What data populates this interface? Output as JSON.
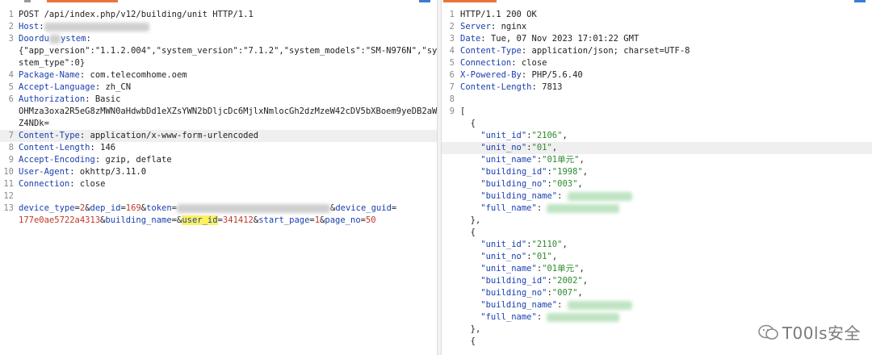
{
  "request": {
    "lines": [
      {
        "n": "1",
        "parts": [
          {
            "c": "val",
            "t": "POST /api/index.php/v12/building/unit HTTP/1.1"
          }
        ]
      },
      {
        "n": "2",
        "parts": [
          {
            "c": "key",
            "t": "Host"
          },
          {
            "c": "val",
            "t": ":"
          },
          {
            "blur": "gray",
            "w": 130
          }
        ]
      },
      {
        "n": "3",
        "parts": [
          {
            "c": "key",
            "t": "Doordu"
          },
          {
            "blur": "gray",
            "w": 14
          },
          {
            "c": "key",
            "t": "ystem"
          },
          {
            "c": "val",
            "t": ":"
          }
        ]
      },
      {
        "n": "",
        "parts": [
          {
            "c": "val",
            "t": "{\"app_version\":\"1.1.2.004\",\"system_version\":\"7.1.2\",\"system_models\":\"SM-N976N\",\"sy"
          }
        ]
      },
      {
        "n": "",
        "parts": [
          {
            "c": "val",
            "t": "stem_type\":0}"
          }
        ]
      },
      {
        "n": "4",
        "parts": [
          {
            "c": "key",
            "t": "Package-Name"
          },
          {
            "c": "val",
            "t": ": com.telecomhome.oem"
          }
        ]
      },
      {
        "n": "5",
        "parts": [
          {
            "c": "key",
            "t": "Accept-Language"
          },
          {
            "c": "val",
            "t": ": zh_CN"
          }
        ]
      },
      {
        "n": "6",
        "parts": [
          {
            "c": "key",
            "t": "Authorization"
          },
          {
            "c": "val",
            "t": ": Basic"
          }
        ]
      },
      {
        "n": "",
        "parts": [
          {
            "c": "val",
            "t": "OHMza3oxa2R5eG8zMWN0aHdwbDd1eXZsYWN2bDljcDc6MjlxNmlocGh2dzMzeW42cDV5bXBoem9yeDB2aW"
          }
        ]
      },
      {
        "n": "",
        "parts": [
          {
            "c": "val",
            "t": "Z4NDk="
          }
        ]
      },
      {
        "n": "7",
        "hl": true,
        "parts": [
          {
            "c": "key",
            "t": "Content-Type"
          },
          {
            "c": "val",
            "t": ": application/x-www-form-urlencoded"
          }
        ]
      },
      {
        "n": "8",
        "parts": [
          {
            "c": "key",
            "t": "Content-Length"
          },
          {
            "c": "val",
            "t": ": 146"
          }
        ]
      },
      {
        "n": "9",
        "parts": [
          {
            "c": "key",
            "t": "Accept-Encoding"
          },
          {
            "c": "val",
            "t": ": gzip, deflate"
          }
        ]
      },
      {
        "n": "10",
        "parts": [
          {
            "c": "key",
            "t": "User-Agent"
          },
          {
            "c": "val",
            "t": ": okhttp/3.11.0"
          }
        ]
      },
      {
        "n": "11",
        "parts": [
          {
            "c": "key",
            "t": "Connection"
          },
          {
            "c": "val",
            "t": ": close"
          }
        ]
      },
      {
        "n": "12",
        "parts": []
      },
      {
        "n": "13",
        "parts": [
          {
            "c": "key",
            "t": "device_type"
          },
          {
            "c": "amp",
            "t": "="
          },
          {
            "c": "pval",
            "t": "2"
          },
          {
            "c": "amp",
            "t": "&"
          },
          {
            "c": "key",
            "t": "dep_id"
          },
          {
            "c": "amp",
            "t": "="
          },
          {
            "c": "pval",
            "t": "169"
          },
          {
            "c": "amp",
            "t": "&"
          },
          {
            "c": "key",
            "t": "token"
          },
          {
            "c": "amp",
            "t": "="
          },
          {
            "blur": "gray",
            "w": 190
          },
          {
            "c": "amp",
            "t": "&"
          },
          {
            "c": "key",
            "t": "device_guid"
          },
          {
            "c": "amp",
            "t": "="
          }
        ]
      },
      {
        "n": "",
        "parts": [
          {
            "c": "pval",
            "t": "177e0ae5722a4313"
          },
          {
            "c": "amp",
            "t": "&"
          },
          {
            "c": "key",
            "t": "building_name"
          },
          {
            "c": "amp",
            "t": "=&"
          },
          {
            "c": "key hlword",
            "t": "user_id"
          },
          {
            "c": "amp",
            "t": "="
          },
          {
            "c": "pval",
            "t": "341412"
          },
          {
            "c": "amp",
            "t": "&"
          },
          {
            "c": "key",
            "t": "start_page"
          },
          {
            "c": "amp",
            "t": "="
          },
          {
            "c": "pval",
            "t": "1"
          },
          {
            "c": "amp",
            "t": "&"
          },
          {
            "c": "key",
            "t": "page_no"
          },
          {
            "c": "amp",
            "t": "="
          },
          {
            "c": "pval",
            "t": "50"
          }
        ]
      }
    ]
  },
  "response": {
    "lines": [
      {
        "n": "1",
        "parts": [
          {
            "c": "val",
            "t": "HTTP/1.1 200 OK"
          }
        ]
      },
      {
        "n": "2",
        "parts": [
          {
            "c": "key",
            "t": "Server"
          },
          {
            "c": "val",
            "t": ": nginx"
          }
        ]
      },
      {
        "n": "3",
        "parts": [
          {
            "c": "key",
            "t": "Date"
          },
          {
            "c": "val",
            "t": ": Tue, 07 Nov 2023 17:01:22 GMT"
          }
        ]
      },
      {
        "n": "4",
        "parts": [
          {
            "c": "key",
            "t": "Content-Type"
          },
          {
            "c": "val",
            "t": ": application/json; charset=UTF-8"
          }
        ]
      },
      {
        "n": "5",
        "parts": [
          {
            "c": "key",
            "t": "Connection"
          },
          {
            "c": "val",
            "t": ": close"
          }
        ]
      },
      {
        "n": "6",
        "parts": [
          {
            "c": "key",
            "t": "X-Powered-By"
          },
          {
            "c": "val",
            "t": ": PHP/5.6.40"
          }
        ]
      },
      {
        "n": "7",
        "parts": [
          {
            "c": "key",
            "t": "Content-Length"
          },
          {
            "c": "val",
            "t": ": 7813"
          }
        ]
      },
      {
        "n": "8",
        "parts": []
      },
      {
        "n": "9",
        "parts": [
          {
            "c": "val",
            "t": "["
          }
        ]
      },
      {
        "n": "",
        "parts": [
          {
            "c": "val",
            "t": "  {"
          }
        ]
      },
      {
        "n": "",
        "parts": [
          {
            "c": "jkey",
            "t": "    \"unit_id\""
          },
          {
            "c": "val",
            "t": ":"
          },
          {
            "c": "str",
            "t": "\"2106\""
          },
          {
            "c": "val",
            "t": ","
          }
        ]
      },
      {
        "n": "",
        "hl": true,
        "parts": [
          {
            "c": "jkey",
            "t": "    \"unit_no\""
          },
          {
            "c": "val",
            "t": ":"
          },
          {
            "c": "str",
            "t": "\"01\""
          },
          {
            "c": "val",
            "t": ","
          }
        ]
      },
      {
        "n": "",
        "parts": [
          {
            "c": "jkey",
            "t": "    \"unit_name\""
          },
          {
            "c": "val",
            "t": ":"
          },
          {
            "c": "str",
            "t": "\"01单元\""
          },
          {
            "c": "val",
            "t": ","
          }
        ]
      },
      {
        "n": "",
        "parts": [
          {
            "c": "jkey",
            "t": "    \"building_id\""
          },
          {
            "c": "val",
            "t": ":"
          },
          {
            "c": "str",
            "t": "\"1998\""
          },
          {
            "c": "val",
            "t": ","
          }
        ]
      },
      {
        "n": "",
        "parts": [
          {
            "c": "jkey",
            "t": "    \"building_no\""
          },
          {
            "c": "val",
            "t": ":"
          },
          {
            "c": "str",
            "t": "\"003\""
          },
          {
            "c": "val",
            "t": ","
          }
        ]
      },
      {
        "n": "",
        "parts": [
          {
            "c": "jkey",
            "t": "    \"building_name\""
          },
          {
            "c": "val",
            "t": ": "
          },
          {
            "blur": "green",
            "w": 80
          }
        ]
      },
      {
        "n": "",
        "parts": [
          {
            "c": "jkey",
            "t": "    \"full_name\""
          },
          {
            "c": "val",
            "t": ": "
          },
          {
            "blur": "green",
            "w": 90
          }
        ]
      },
      {
        "n": "",
        "parts": [
          {
            "c": "val",
            "t": "  },"
          }
        ]
      },
      {
        "n": "",
        "parts": [
          {
            "c": "val",
            "t": "  {"
          }
        ]
      },
      {
        "n": "",
        "parts": [
          {
            "c": "jkey",
            "t": "    \"unit_id\""
          },
          {
            "c": "val",
            "t": ":"
          },
          {
            "c": "str",
            "t": "\"2110\""
          },
          {
            "c": "val",
            "t": ","
          }
        ]
      },
      {
        "n": "",
        "parts": [
          {
            "c": "jkey",
            "t": "    \"unit_no\""
          },
          {
            "c": "val",
            "t": ":"
          },
          {
            "c": "str",
            "t": "\"01\""
          },
          {
            "c": "val",
            "t": ","
          }
        ]
      },
      {
        "n": "",
        "parts": [
          {
            "c": "jkey",
            "t": "    \"unit_name\""
          },
          {
            "c": "val",
            "t": ":"
          },
          {
            "c": "str",
            "t": "\"01单元\""
          },
          {
            "c": "val",
            "t": ","
          }
        ]
      },
      {
        "n": "",
        "parts": [
          {
            "c": "jkey",
            "t": "    \"building_id\""
          },
          {
            "c": "val",
            "t": ":"
          },
          {
            "c": "str",
            "t": "\"2002\""
          },
          {
            "c": "val",
            "t": ","
          }
        ]
      },
      {
        "n": "",
        "parts": [
          {
            "c": "jkey",
            "t": "    \"building_no\""
          },
          {
            "c": "val",
            "t": ":"
          },
          {
            "c": "str",
            "t": "\"007\""
          },
          {
            "c": "val",
            "t": ","
          }
        ]
      },
      {
        "n": "",
        "parts": [
          {
            "c": "jkey",
            "t": "    \"building_name\""
          },
          {
            "c": "val",
            "t": ": "
          },
          {
            "blur": "green",
            "w": 80
          }
        ]
      },
      {
        "n": "",
        "parts": [
          {
            "c": "jkey",
            "t": "    \"full_name\""
          },
          {
            "c": "val",
            "t": ": "
          },
          {
            "blur": "green",
            "w": 90
          }
        ]
      },
      {
        "n": "",
        "parts": [
          {
            "c": "val",
            "t": "  },"
          }
        ]
      },
      {
        "n": "",
        "parts": [
          {
            "c": "val",
            "t": "  {"
          }
        ]
      }
    ]
  },
  "watermark": {
    "text": "T00ls安全"
  }
}
